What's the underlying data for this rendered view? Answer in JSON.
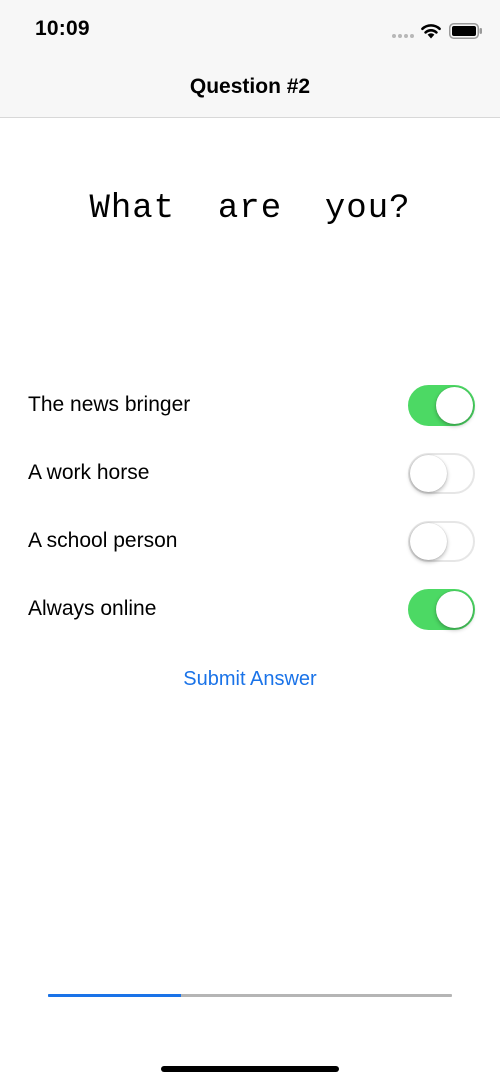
{
  "status_bar": {
    "time": "10:09",
    "signal_icon": "signal-dots-icon",
    "wifi_icon": "wifi-icon",
    "battery_icon": "battery-icon"
  },
  "nav": {
    "title": "Question #2"
  },
  "question": {
    "text": "What  are  you?"
  },
  "options": [
    {
      "label": "The news bringer",
      "on": true
    },
    {
      "label": "A work horse",
      "on": false
    },
    {
      "label": "A school person",
      "on": false
    },
    {
      "label": "Always online",
      "on": true
    }
  ],
  "submit": {
    "label": "Submit Answer"
  },
  "progress": {
    "fraction": 0.33
  },
  "colors": {
    "accent": "#1a73e8",
    "toggle_on": "#4cd964",
    "toggle_off_border": "#e6e6e6",
    "nav_background": "#f7f7f7"
  }
}
